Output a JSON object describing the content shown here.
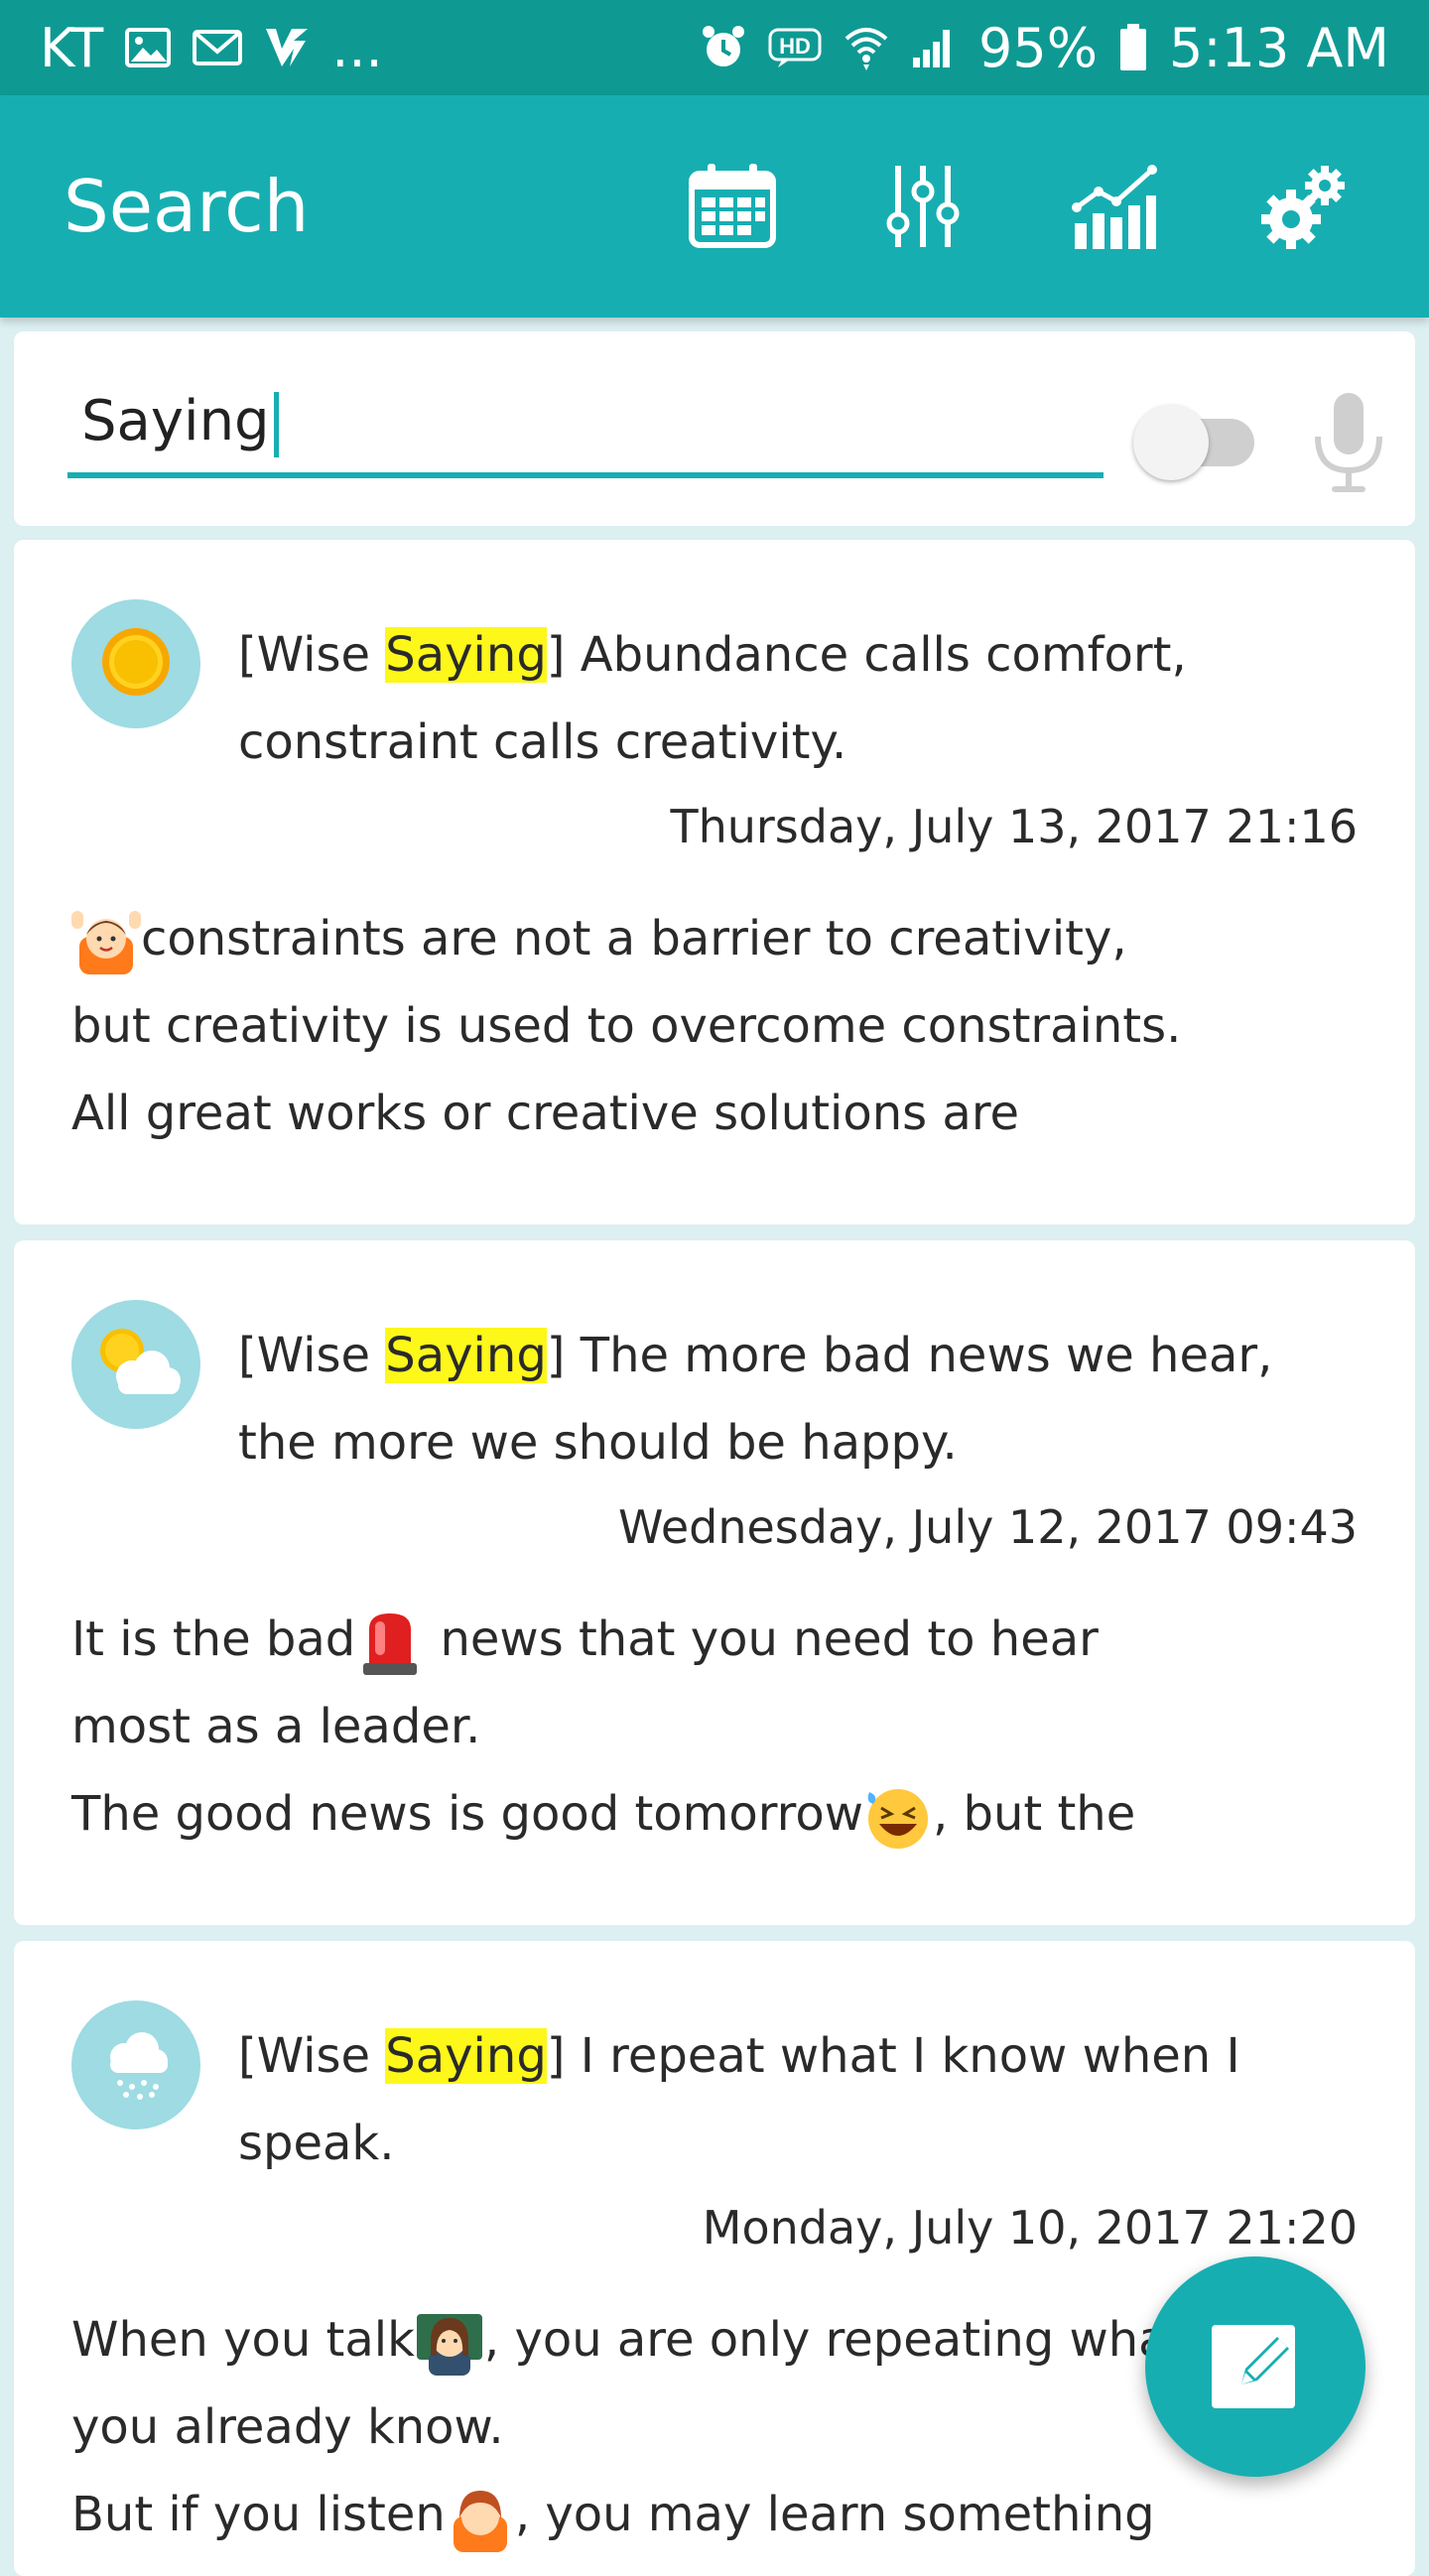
{
  "status_bar": {
    "carrier": "KT",
    "more": "...",
    "battery": "95%",
    "time": "5:13 AM",
    "icons": [
      "image-icon",
      "mail-icon",
      "v-icon",
      "alarm-icon",
      "hd-icon",
      "wifi-icon",
      "signal-icon",
      "battery-icon"
    ]
  },
  "app_bar": {
    "title": "Search",
    "actions": [
      "calendar-icon",
      "filter-sliders-icon",
      "stats-chart-icon",
      "settings-gears-icon"
    ]
  },
  "search": {
    "query": "Saying",
    "toggle_on": false
  },
  "colors": {
    "primary": "#17aeb2",
    "status_bar": "#0e9a93",
    "highlight": "#fdf71a",
    "background": "#dceff1"
  },
  "entries": [
    {
      "weather_icon": "sun-icon",
      "title_prefix": "[Wise ",
      "title_highlight": "Saying",
      "title_suffix": "] Abundance calls comfort, constraint calls creativity.",
      "date": "Thursday, July 13, 2017 21:16",
      "body": [
        {
          "emoji": "person-raising-hands-emoji",
          "text": "constraints are not a barrier to creativity,"
        },
        {
          "text": "but creativity is used to overcome constraints."
        },
        {
          "text": "All great works or creative solutions are"
        }
      ]
    },
    {
      "weather_icon": "partly-cloudy-icon",
      "title_prefix": "[Wise ",
      "title_highlight": "Saying",
      "title_suffix": "] The more bad news we hear, the more we should be happy.",
      "date": "Wednesday, July 12, 2017 09:43",
      "body_parts": {
        "line1_a": "It is the bad",
        "line1_emoji": "siren-emoji",
        "line1_b": " news that you need to hear",
        "line2": "most as a leader.",
        "line3_a": "The good news is good tomorrow",
        "line3_emoji": "laughing-emoji",
        "line3_b": ", but the"
      }
    },
    {
      "weather_icon": "rain-cloud-icon",
      "title_prefix": "[Wise ",
      "title_highlight": "Saying",
      "title_suffix": "] I repeat what I know when I speak.",
      "date": "Monday, July 10, 2017 21:20",
      "body_parts": {
        "line1_a": "When you talk",
        "line1_emoji": "teacher-emoji",
        "line1_b": ", you are only repeating what",
        "line2": "you already know.",
        "line3_a": "But if you listen",
        "line3_emoji": "person-emoji",
        "line3_b": ", you may learn something"
      }
    }
  ],
  "fab": {
    "icon": "edit-pencil-icon"
  }
}
